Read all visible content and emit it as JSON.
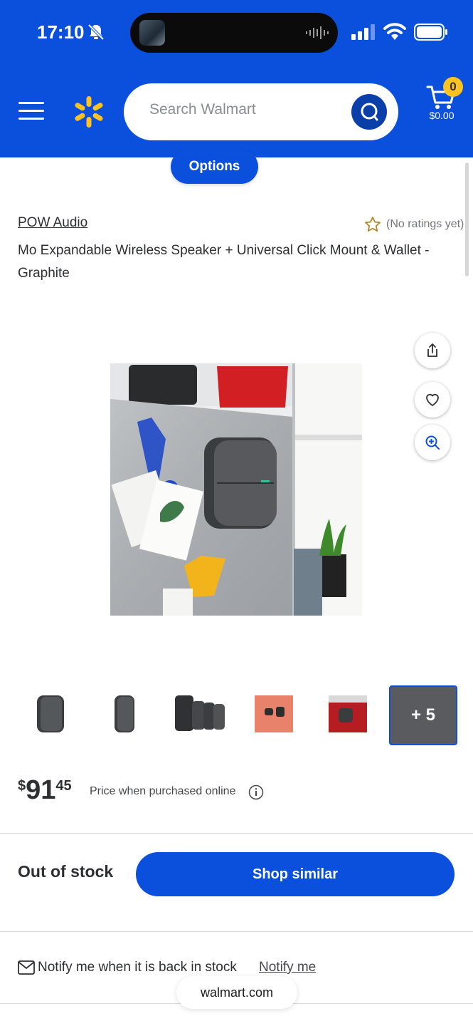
{
  "status_bar": {
    "time": "17:10"
  },
  "header": {
    "search_placeholder": "Search Walmart",
    "cart_count": "0",
    "cart_total": "$0.00"
  },
  "options_label": "Options",
  "product": {
    "brand": "POW Audio",
    "ratings_text": "(No ratings yet)",
    "title": "Mo Expandable Wireless Speaker + Universal Click Mount & Wallet - Graphite",
    "thumbnails_more": "+ 5",
    "price": {
      "currency": "$",
      "dollars": "91",
      "cents": "45"
    },
    "price_note": "Price when purchased online"
  },
  "availability": {
    "status": "Out of stock",
    "shop_similar_label": "Shop similar",
    "notify_text": "Notify me when it is back in stock",
    "notify_link": "Notify me"
  },
  "browser": {
    "url": "walmart.com"
  },
  "colors": {
    "brand_blue": "#0a50dc",
    "spark_yellow": "#ffc220"
  }
}
